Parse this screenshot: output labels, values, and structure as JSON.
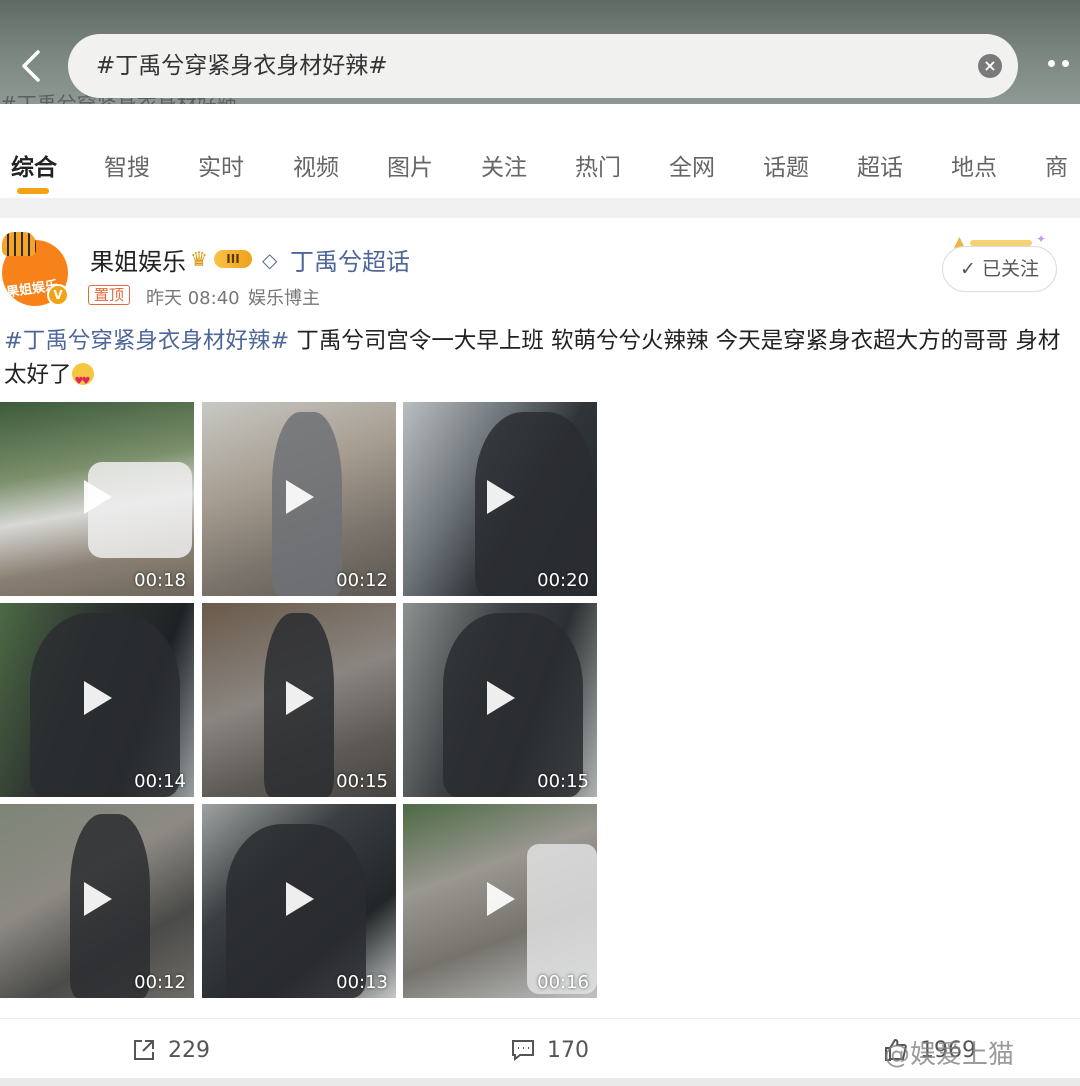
{
  "search": {
    "query": "#丁禹兮穿紧身衣身材好辣#",
    "clear_icon": "close-circle-icon",
    "background_text": "#丁禹兮穿紧身衣身材好辣"
  },
  "tabs": [
    {
      "label": "综合",
      "active": true
    },
    {
      "label": "智搜"
    },
    {
      "label": "实时"
    },
    {
      "label": "视频"
    },
    {
      "label": "图片"
    },
    {
      "label": "关注"
    },
    {
      "label": "热门"
    },
    {
      "label": "全网"
    },
    {
      "label": "话题"
    },
    {
      "label": "超话"
    },
    {
      "label": "地点"
    },
    {
      "label": "商"
    }
  ],
  "post": {
    "author": "果姐娱乐",
    "avatar_text": "果姐娱乐",
    "level_badge": "III",
    "supertopic": "丁禹兮超话",
    "pinned_label": "置顶",
    "time": "昨天 08:40",
    "role": "娱乐博主",
    "follow_label": "✓ 已关注",
    "hashtag": "#丁禹兮穿紧身衣身材好辣#",
    "text": " 丁禹兮司宫令一大早上班 软萌兮兮火辣辣 今天是穿紧身衣超大方的哥哥 身材太好了",
    "videos": [
      {
        "duration": "00:18"
      },
      {
        "duration": "00:12"
      },
      {
        "duration": "00:20"
      },
      {
        "duration": "00:14"
      },
      {
        "duration": "00:15"
      },
      {
        "duration": "00:15"
      },
      {
        "duration": "00:12"
      },
      {
        "duration": "00:13"
      },
      {
        "duration": "00:16"
      }
    ],
    "reposts": "229",
    "comments": "170",
    "likes": "1969"
  },
  "watermark": "@娱爱上猫",
  "colors": {
    "accent": "#f1a313",
    "link": "#4f6798",
    "pin": "#e36c3d"
  }
}
